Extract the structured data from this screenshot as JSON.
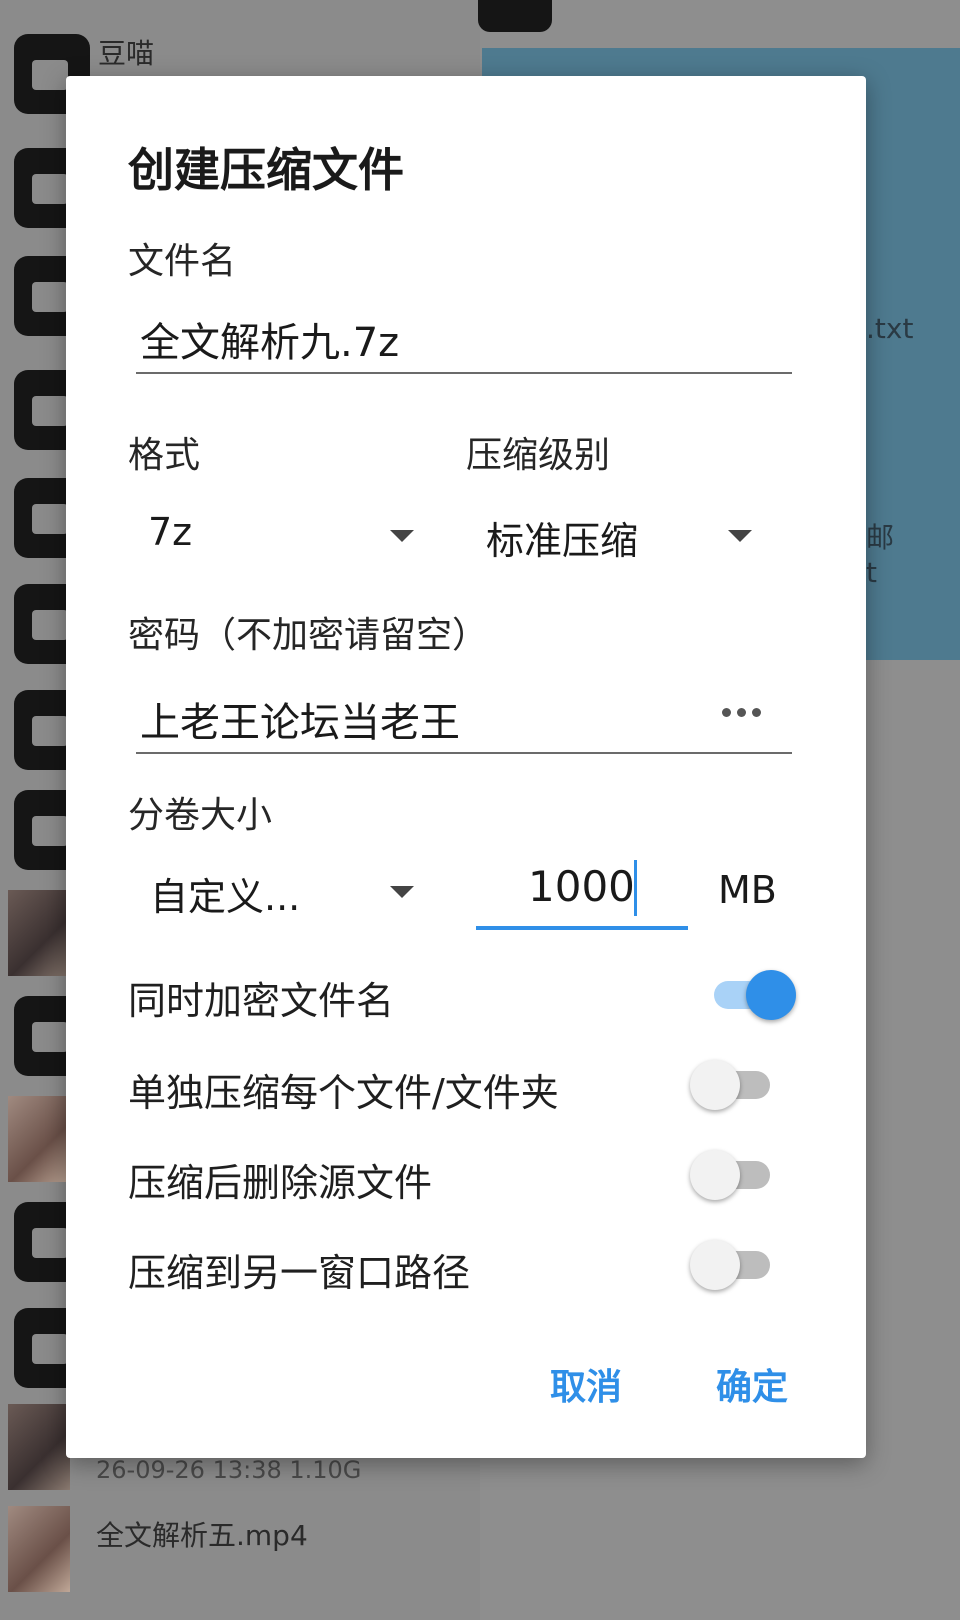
{
  "background": {
    "list_items": [
      {
        "name": "豆喵"
      },
      {
        "name": "26-09-26 13:38  1.10G"
      },
      {
        "name": "全文解析五.mp4"
      }
    ],
    "right_panel_fragments": [
      ".txt",
      "邮",
      "t"
    ]
  },
  "dialog": {
    "title": "创建压缩文件",
    "filename": {
      "label": "文件名",
      "value": "全文解析九.7z"
    },
    "format": {
      "label": "格式",
      "value": "7z"
    },
    "level": {
      "label": "压缩级别",
      "value": "标准压缩"
    },
    "password": {
      "label": "密码（不加密请留空）",
      "value": "上老王论坛当老王"
    },
    "volume": {
      "label": "分卷大小",
      "preset": "自定义...",
      "size": "1000",
      "unit": "MB"
    },
    "options": [
      {
        "label": "同时加密文件名",
        "enabled": true
      },
      {
        "label": "单独压缩每个文件/文件夹",
        "enabled": false
      },
      {
        "label": "压缩后删除源文件",
        "enabled": false
      },
      {
        "label": "压缩到另一窗口路径",
        "enabled": false
      }
    ],
    "actions": {
      "cancel": "取消",
      "confirm": "确定"
    }
  },
  "colors": {
    "accent": "#2f8fe8",
    "scrim": "#7a7a7a",
    "dialog_bg": "#ffffff"
  }
}
